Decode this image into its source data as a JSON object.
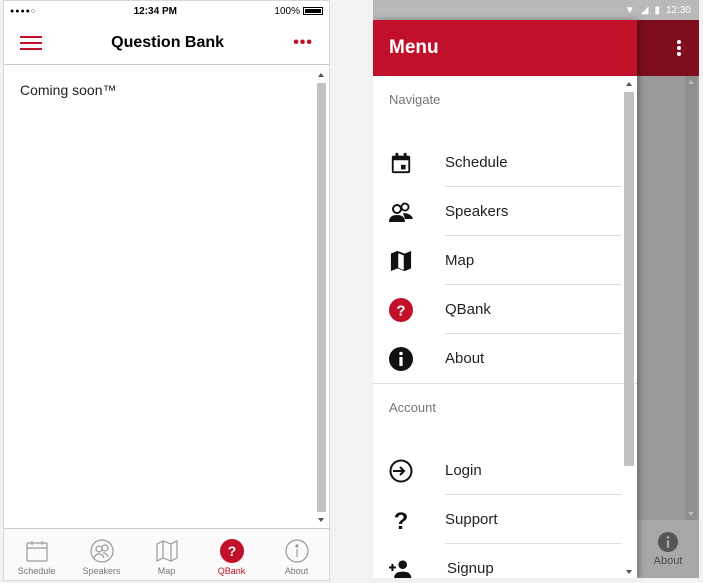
{
  "ios": {
    "status": {
      "carrier_dots": "●●●●○",
      "time": "12:34 PM",
      "battery": "100%"
    },
    "nav": {
      "title": "Question Bank",
      "more": "•••"
    },
    "content_text": "Coming soon™",
    "tabs": [
      {
        "label": "Schedule",
        "icon": "calendar-icon",
        "active": false
      },
      {
        "label": "Speakers",
        "icon": "speakers-icon",
        "active": false
      },
      {
        "label": "Map",
        "icon": "map-icon",
        "active": false
      },
      {
        "label": "QBank",
        "icon": "question-circle-icon",
        "active": true
      },
      {
        "label": "About",
        "icon": "info-circle-icon",
        "active": false
      }
    ]
  },
  "android": {
    "status": {
      "time": "12:30"
    },
    "drawer": {
      "title": "Menu",
      "sections": [
        {
          "label": "Navigate",
          "items": [
            {
              "label": "Schedule",
              "icon": "calendar-icon"
            },
            {
              "label": "Speakers",
              "icon": "speakers-icon"
            },
            {
              "label": "Map",
              "icon": "map-icon"
            },
            {
              "label": "QBank",
              "icon": "question-circle-icon"
            },
            {
              "label": "About",
              "icon": "info-circle-icon"
            }
          ]
        },
        {
          "label": "Account",
          "items": [
            {
              "label": "Login",
              "icon": "login-icon"
            },
            {
              "label": "Support",
              "icon": "question-mark-icon"
            },
            {
              "label": "Signup",
              "icon": "add-user-icon"
            }
          ]
        }
      ]
    },
    "background_tab": {
      "label": "About",
      "icon": "info-circle-icon"
    }
  },
  "colors": {
    "accent": "#c0102a",
    "accent_dark": "#7e0e1d",
    "overlay": "#9b9b9b"
  }
}
